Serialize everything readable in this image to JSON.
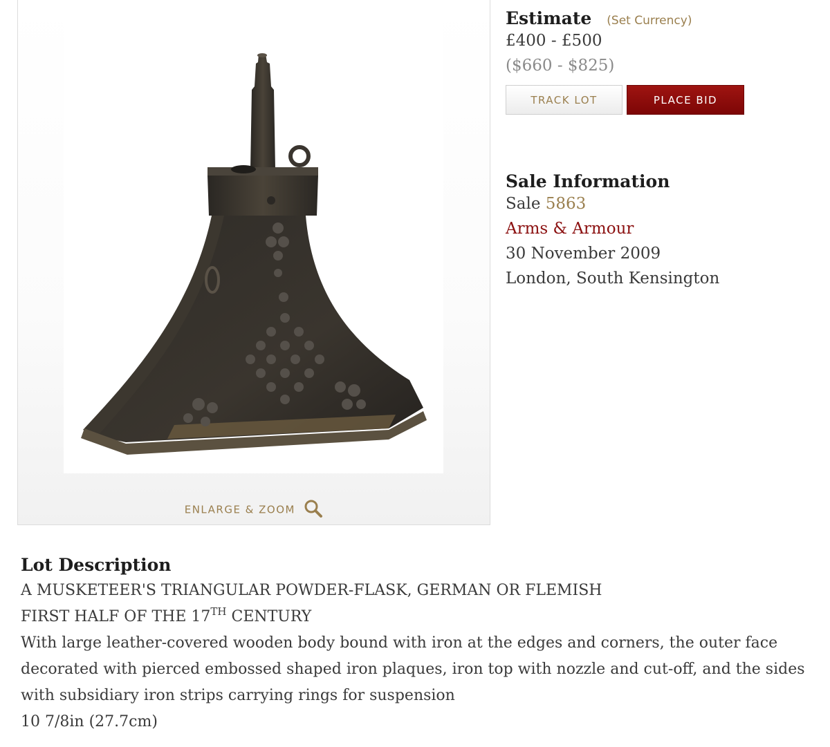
{
  "image_panel": {
    "enlarge_label": "ENLARGE & ZOOM"
  },
  "estimate": {
    "heading": "Estimate",
    "set_currency": "(Set Currency)",
    "gbp_range": "£400 - £500",
    "usd_range": "($660 - $825)"
  },
  "actions": {
    "track_lot": "TRACK LOT",
    "place_bid": "PLACE BID"
  },
  "sale_info": {
    "heading": "Sale Information",
    "sale_prefix": "Sale",
    "sale_number": "5863",
    "sale_name": "Arms & Armour",
    "date": "30 November 2009",
    "location": "London, South Kensington"
  },
  "lot_description": {
    "heading": "Lot Description",
    "title_line1": "A MUSKETEER'S TRIANGULAR POWDER-FLASK, GERMAN OR FLEMISH",
    "title_line2_prefix": "FIRST HALF OF THE 17",
    "title_line2_sup": "TH",
    "title_line2_suffix": " CENTURY",
    "body": "With large leather-covered wooden body bound with iron at the edges and corners, the outer face decorated with pierced embossed shaped iron plaques, iron top with nozzle and cut-off, and the sides with subsidiary iron strips carrying rings for suspension",
    "dimensions": "10 7/8in (27.7cm)"
  },
  "colors": {
    "gold_link": "#9a7f4e",
    "bid_red": "#8b0a0a",
    "sale_name_red": "#8b1010"
  }
}
